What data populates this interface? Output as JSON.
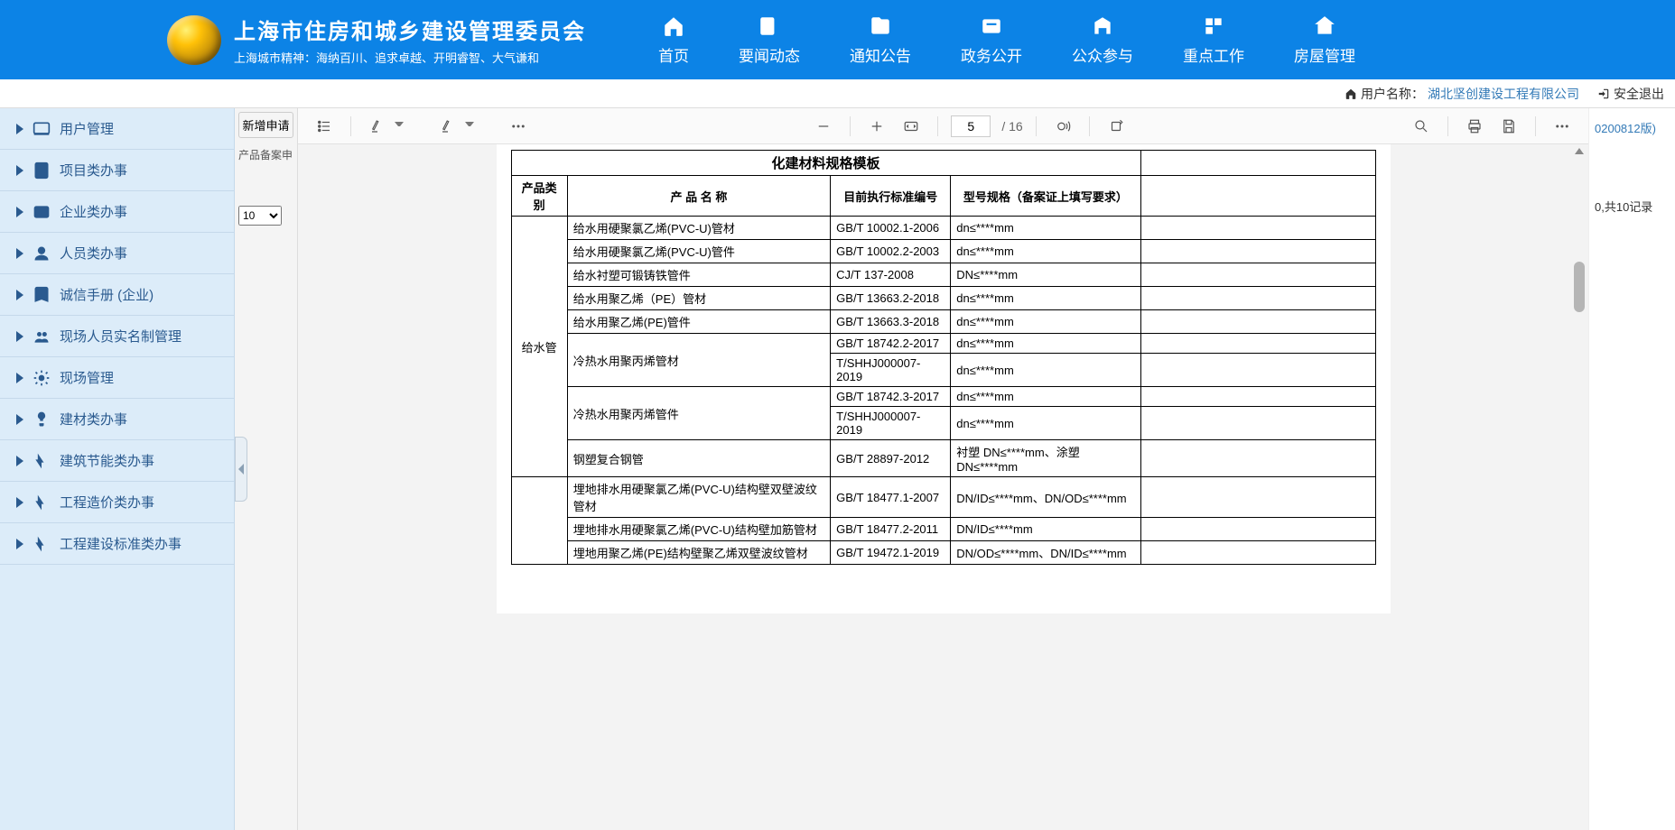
{
  "header": {
    "title": "上海市住房和城乡建设管理委员会",
    "subtitle": "上海城市精神：海纳百川、追求卓越、开明睿智、大气谦和",
    "nav": [
      "首页",
      "要闻动态",
      "通知公告",
      "政务公开",
      "公众参与",
      "重点工作",
      "房屋管理"
    ]
  },
  "subbar": {
    "user_label": "用户名称：",
    "user_name": "湖北坚创建设工程有限公司",
    "logout": "安全退出"
  },
  "sidebar": {
    "items": [
      "用户管理",
      "项目类办事",
      "企业类办事",
      "人员类办事",
      "诚信手册 (企业)",
      "现场人员实名制管理",
      "现场管理",
      "建材类办事",
      "建筑节能类办事",
      "工程造价类办事",
      "工程建设标准类办事"
    ]
  },
  "midcol": {
    "newapply": "新增申请",
    "label": "产品备案申",
    "select_value": "10"
  },
  "pdf": {
    "page_current": "5",
    "page_total": "/ 16"
  },
  "doc": {
    "title": "化建材料规格模板",
    "headers": [
      "产品类别",
      "产 品 名 称",
      "目前执行标准编号",
      "型号规格（备案证上填写要求）"
    ],
    "cat1": "给水管",
    "rows": [
      {
        "name": "给水用硬聚氯乙烯(PVC-U)管材",
        "std": "GB/T 10002.1-2006",
        "spec": "dn≤****mm"
      },
      {
        "name": "给水用硬聚氯乙烯(PVC-U)管件",
        "std": "GB/T 10002.2-2003",
        "spec": "dn≤****mm"
      },
      {
        "name": "给水衬塑可锻铸铁管件",
        "std": "CJ/T 137-2008",
        "spec": "DN≤****mm"
      },
      {
        "name": "给水用聚乙烯（PE）管材",
        "std": "GB/T 13663.2-2018",
        "spec": "dn≤****mm"
      },
      {
        "name": "给水用聚乙烯(PE)管件",
        "std": "GB/T 13663.3-2018",
        "spec": "dn≤****mm"
      },
      {
        "name": "冷热水用聚丙烯管材",
        "std": "GB/T 18742.2-2017",
        "spec": "dn≤****mm",
        "rowspan": 2
      },
      {
        "std": "T/SHHJ000007-2019",
        "spec": "dn≤****mm"
      },
      {
        "name": "冷热水用聚丙烯管件",
        "std": "GB/T 18742.3-2017",
        "spec": "dn≤****mm",
        "rowspan": 2
      },
      {
        "std": "T/SHHJ000007-2019",
        "spec": "dn≤****mm"
      },
      {
        "name": "钢塑复合钢管",
        "std": "GB/T 28897-2012",
        "spec": "衬塑 DN≤****mm、涂塑DN≤****mm"
      }
    ],
    "rows2": [
      {
        "name": "埋地排水用硬聚氯乙烯(PVC-U)结构壁双壁波纹管材",
        "std": "GB/T 18477.1-2007",
        "spec": "DN/ID≤****mm、DN/OD≤****mm"
      },
      {
        "name": "埋地排水用硬聚氯乙烯(PVC-U)结构壁加筋管材",
        "std": "GB/T 18477.2-2011",
        "spec": "DN/ID≤****mm"
      },
      {
        "name": "埋地用聚乙烯(PE)结构壁聚乙烯双壁波纹管材",
        "std": "GB/T 19472.1-2019",
        "spec": "DN/OD≤****mm、DN/ID≤****mm"
      }
    ]
  },
  "right": {
    "link1": "0200812版)",
    "records": "0,共10记录"
  }
}
